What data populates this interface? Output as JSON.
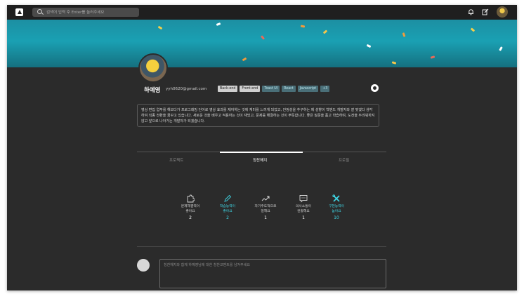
{
  "search": {
    "placeholder": "검색어 입력 후 Enter를 눌러주세요"
  },
  "profile": {
    "name": "하예영",
    "email": "yyh0620@gmail.com",
    "tags": [
      {
        "label": "Back-end",
        "style": "gray"
      },
      {
        "label": "Front-end",
        "style": "gray"
      },
      {
        "label": "Toast UI",
        "style": "blue"
      },
      {
        "label": "React",
        "style": "blue"
      },
      {
        "label": "Javascript",
        "style": "blue"
      },
      {
        "label": "+3",
        "style": "blue"
      }
    ],
    "bio": "영상 편집 업무를 해오다가 프로그래밍 언어로 영상 효과를 제어하는 것에 재미를 느끼게 되었고, 안정성을 추구하는 제 성향이 백엔드 개발자와 잘 맞겠다 생각하여 직종 전환을 꿈꾸고 있습니다. 새로운 것을 배우고 적용하는 것이 재밌고, 문제를 해결하는 것이 뿌듯합니다. 좋은 질문을 품고 학습하며, 도전을 두려워하지 않고 앞으로 나아가는 개발자가 되겠습니다."
  },
  "tabs": [
    {
      "label": "프로젝트",
      "active": false
    },
    {
      "label": "칭찬해지",
      "active": true
    },
    {
      "label": "프로필",
      "active": false
    }
  ],
  "stats": [
    {
      "label": "문제해결력이\n좋아요",
      "count": "2",
      "icon": "puzzle-icon",
      "highlight": false
    },
    {
      "label": "학습능력이\n좋아요",
      "count": "2",
      "icon": "pencil-icon",
      "highlight": true
    },
    {
      "label": "자기주도적으로\n일해요",
      "count": "1",
      "icon": "trend-icon",
      "highlight": false
    },
    {
      "label": "의사소통이\n원활해요",
      "count": "1",
      "icon": "chat-icon",
      "highlight": false
    },
    {
      "label": "구현능력이\n높아요",
      "count": "10",
      "icon": "tools-icon",
      "highlight": true
    }
  ],
  "comment": {
    "placeholder": "칭찬해지와 함께 하예영님에 대한 칭찬코멘트를 남겨주세요"
  },
  "colors": {
    "accent": "#3fd7e6",
    "background": "#2b2b2b",
    "nav": "#1f1f1f",
    "banner": "#1aa0b3"
  }
}
